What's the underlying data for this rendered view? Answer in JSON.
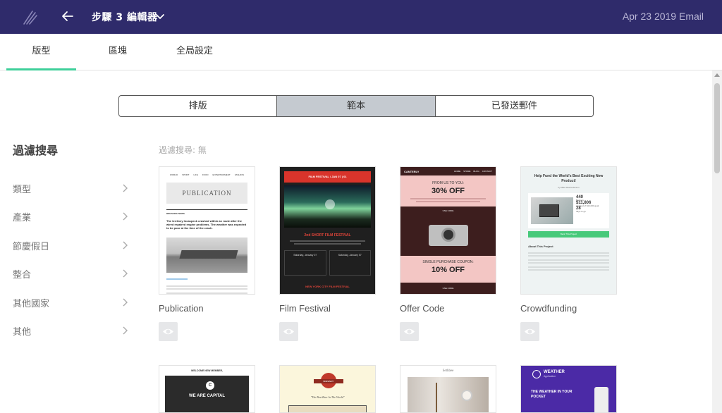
{
  "topbar": {
    "step_title": "步驟 3 編輯器",
    "email_name": "Apr 23 2019 Email"
  },
  "tabs": [
    {
      "label": "版型"
    },
    {
      "label": "區塊"
    },
    {
      "label": "全局設定"
    }
  ],
  "segment": [
    {
      "label": "排版"
    },
    {
      "label": "範本"
    },
    {
      "label": "已發送郵件"
    }
  ],
  "sidebar": {
    "title": "過濾搜尋",
    "items": [
      {
        "label": "類型"
      },
      {
        "label": "產業"
      },
      {
        "label": "節慶假日"
      },
      {
        "label": "整合"
      },
      {
        "label": "其他國家"
      },
      {
        "label": "其他"
      }
    ]
  },
  "filter_state": "過濾搜尋: 無",
  "templates": [
    {
      "name": "Publication",
      "preview": {
        "nav": [
          "WORLD",
          "SPORT",
          "LIFE",
          "FOOD",
          "ENTERTAINMENT",
          "FASHION"
        ],
        "masthead": "PUBLICATION",
        "section": "BREAKING NEWS",
        "headline": "The territory Incaspeck crashed within an route after the wired repaired engine problems. The weather was expected to be poor at the time of the crash."
      }
    },
    {
      "name": "Film Festival",
      "preview": {
        "banner": "FILM FESTIVAL / JAN 07 | 01",
        "heading": "2nd SHORT FILM FESTIVAL",
        "date_left": "Saturday, January 07",
        "date_right": "Saturday, January 07",
        "footer": "NEW YORK CITY FILM FESTIVAL"
      }
    },
    {
      "name": "Offer Code",
      "preview": {
        "brand": "CANTERLY",
        "nav": [
          "HOME",
          "STORE",
          "BLOG",
          "CONTACT"
        ],
        "top_small": "FROM US TO YOU:",
        "top_big": "30% OFF",
        "code1": "USE CODE",
        "mid_small": "SINGLE PURCHASE COUPON:",
        "mid_big": "10% OFF",
        "code2": "USE CODE"
      }
    },
    {
      "name": "Crowdfunding",
      "preview": {
        "heading": "Help Fund the World's Best Exciting New Product!",
        "byline": "by Mike Rita Anderson",
        "stat1": "440",
        "stat1_label": "Backers",
        "stat2": "$11,806",
        "stat2_label": "pledged of $14,000 goal",
        "stat3": "28",
        "stat3_label": "days to go",
        "cta": "Back This Project",
        "about": "About This Project"
      }
    }
  ],
  "templates_row2": [
    {
      "preview": {
        "top": "WELCOME NEW MEMBER,",
        "logo_letter": "C",
        "title": "WE ARE CAPITAL"
      }
    },
    {
      "preview": {
        "badge": "BREWERY",
        "tagline": "\"The Best Beer In The World\""
      }
    },
    {
      "preview": {
        "brand": "Sethbee"
      }
    },
    {
      "preview": {
        "brand": "WEATHER",
        "brand_sub": "Application",
        "title": "THE WEATHER IN YOUR POCKET"
      }
    }
  ],
  "colors": {
    "topbar": "#2f2b6b",
    "tab_accent": "#3ecf9a",
    "segment_active": "#c5cad0"
  }
}
